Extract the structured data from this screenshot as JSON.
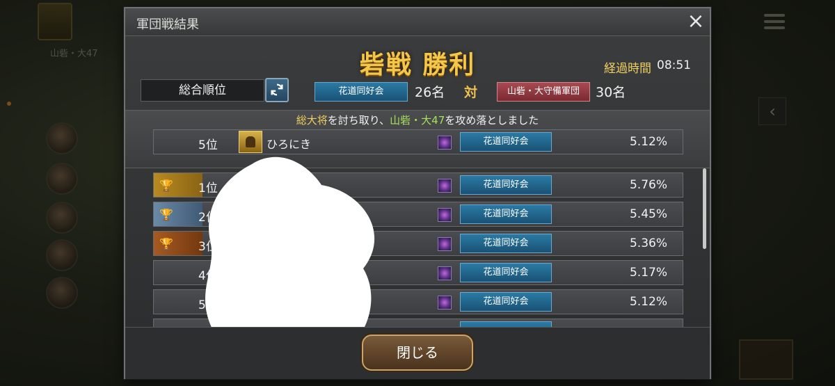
{
  "background": {
    "location": "山砦・大47"
  },
  "dialog": {
    "title": "軍団戦結果",
    "close_icon": "×",
    "result_title": "砦戦 勝利",
    "elapsed_label": "経過時間",
    "elapsed_value": "08:51"
  },
  "ranking_select": "総合順位",
  "matchup": {
    "team_a": "花道同好会",
    "team_a_count": "26名",
    "vs": "対",
    "team_b": "山砦・大守備軍団",
    "team_b_count": "30名"
  },
  "announcement": {
    "part1": "総大将",
    "part2": "を討ち取り、",
    "part3": "山砦・大47",
    "part4": "を攻め落としました"
  },
  "highlight_row": {
    "rank": "5位",
    "name": "ひろにき",
    "team": "花道同好会",
    "pct": "5.12%"
  },
  "rows": [
    {
      "rank": "1位",
      "team": "花道同好会",
      "pct": "5.76%",
      "medal": "gold"
    },
    {
      "rank": "2位",
      "team": "花道同好会",
      "pct": "5.45%",
      "medal": "silver"
    },
    {
      "rank": "3位",
      "team": "花道同好会",
      "pct": "5.36%",
      "medal": "bronze"
    },
    {
      "rank": "4位",
      "team": "花道同好会",
      "pct": "5.17%",
      "medal": "none"
    },
    {
      "rank": "5位",
      "team": "花道同好会",
      "pct": "5.12%",
      "medal": "none"
    }
  ],
  "footer": {
    "close_button": "閉じる"
  },
  "colors": {
    "title_gold": "#f3c84a",
    "team_blue": "#1a5275",
    "team_red": "#7a2a32",
    "highlight_green": "#a8e05a"
  }
}
